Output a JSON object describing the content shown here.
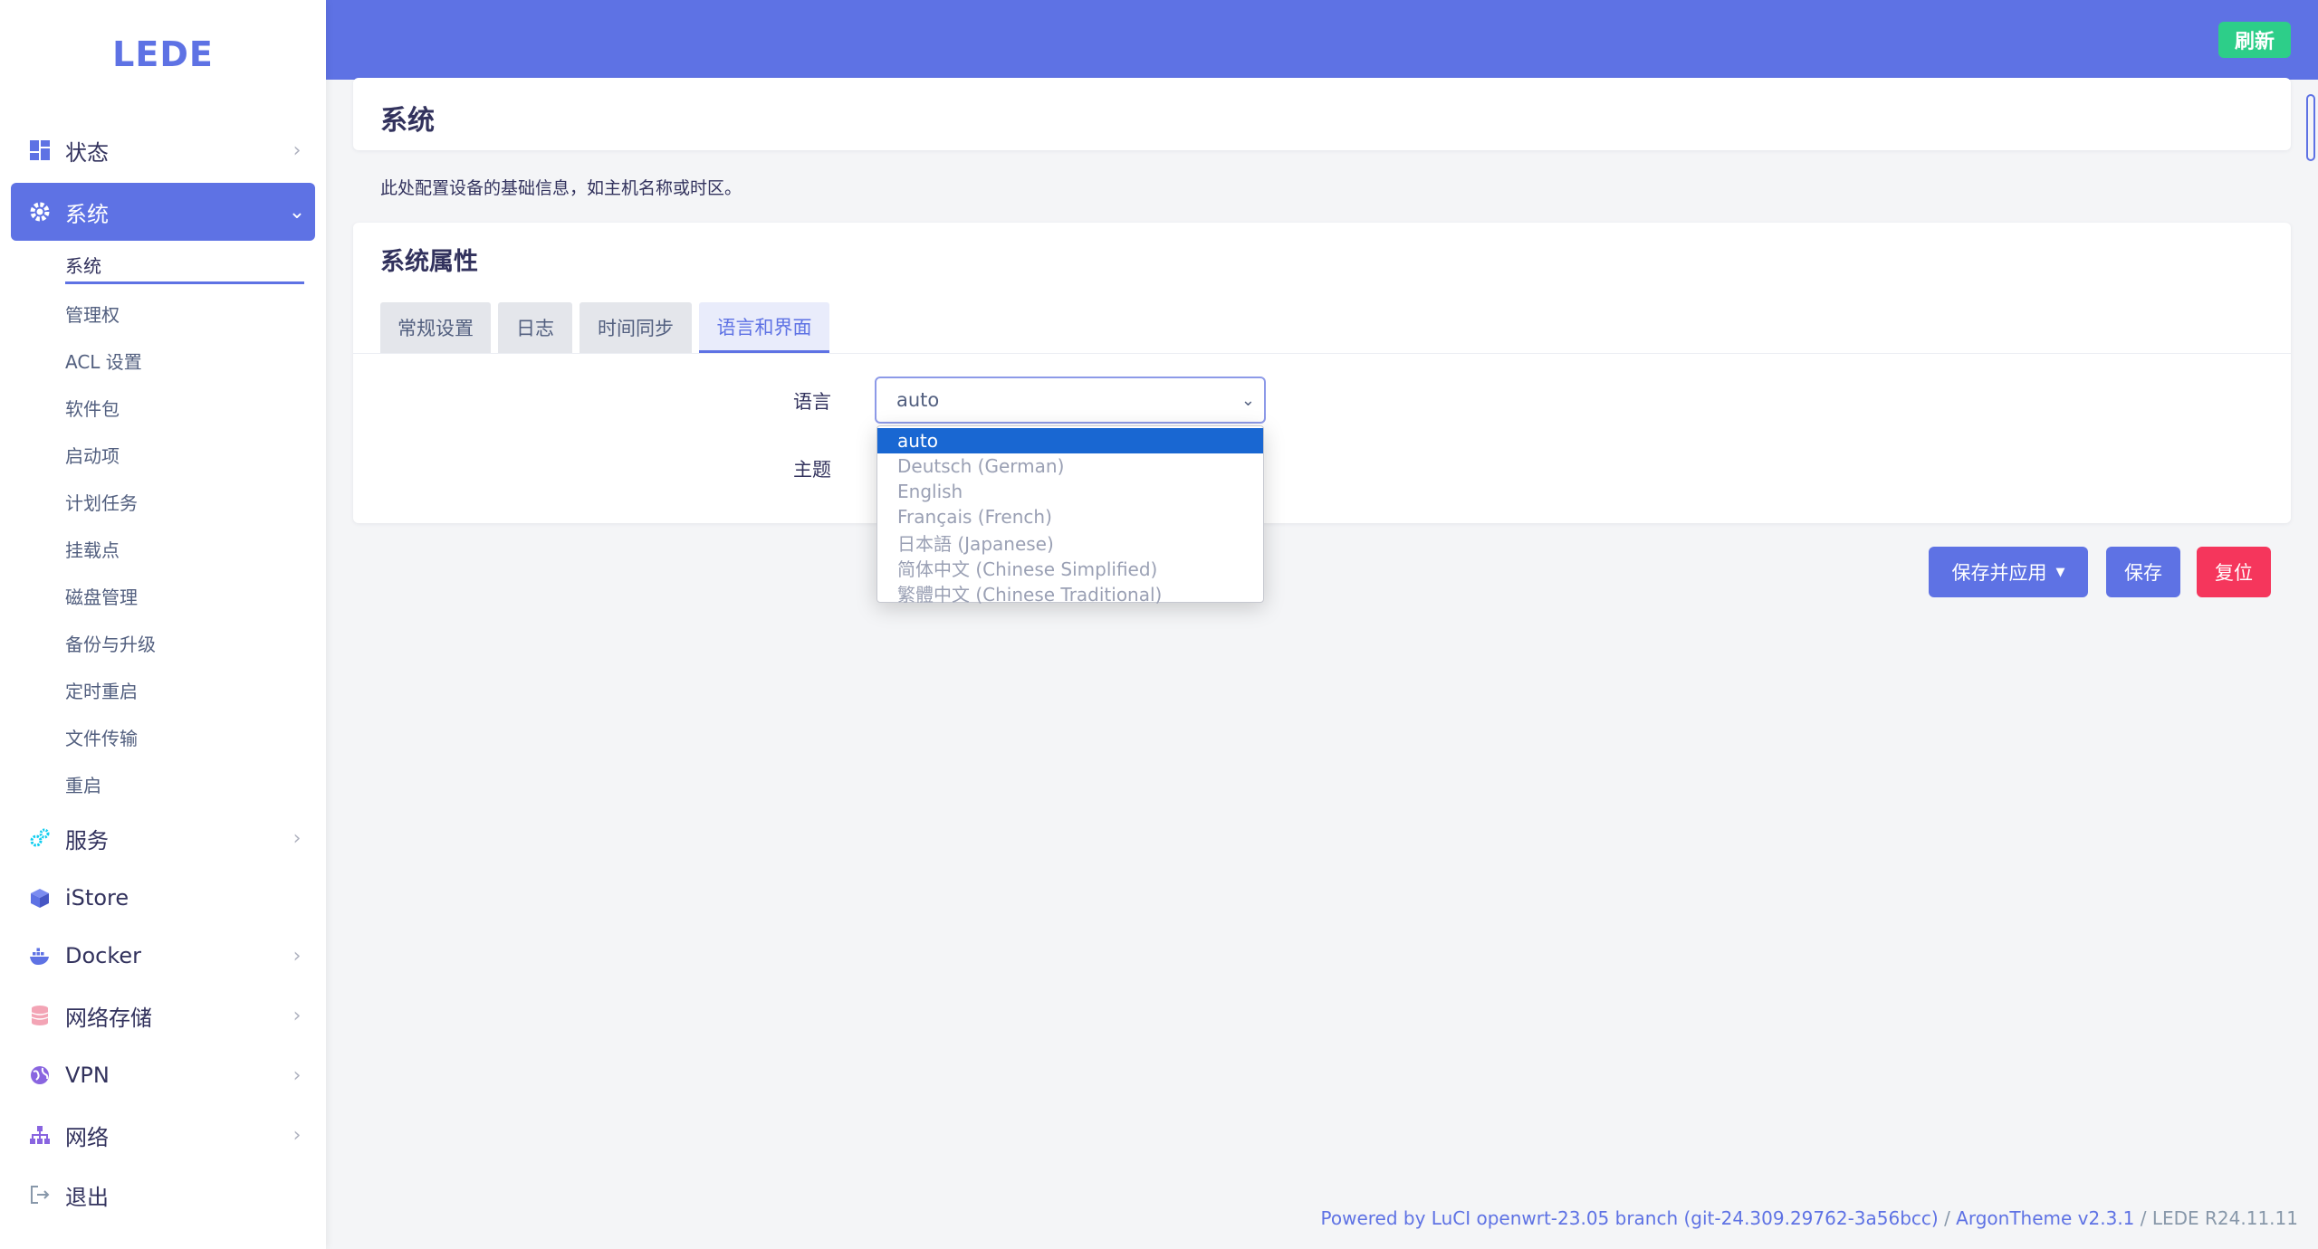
{
  "colors": {
    "accent": "#5e72e4",
    "success": "#2dce89",
    "danger": "#f5365c",
    "dropdown_highlight": "#1967d2"
  },
  "sidebar": {
    "logo": "LEDE",
    "items": [
      {
        "label": "状态",
        "icon": "dashboard-icon"
      },
      {
        "label": "系统",
        "icon": "gear-icon",
        "active": true
      },
      {
        "label": "服务",
        "icon": "gears-icon"
      },
      {
        "label": "iStore",
        "icon": "cube-icon"
      },
      {
        "label": "Docker",
        "icon": "docker-whale-icon"
      },
      {
        "label": "网络存储",
        "icon": "database-icon"
      },
      {
        "label": "VPN",
        "icon": "globe-icon"
      },
      {
        "label": "网络",
        "icon": "network-icon"
      },
      {
        "label": "退出",
        "icon": "logout-icon"
      }
    ],
    "sub_items": [
      {
        "label": "系统",
        "current": true
      },
      {
        "label": "管理权"
      },
      {
        "label": "ACL 设置"
      },
      {
        "label": "软件包"
      },
      {
        "label": "启动项"
      },
      {
        "label": "计划任务"
      },
      {
        "label": "挂载点"
      },
      {
        "label": "磁盘管理"
      },
      {
        "label": "备份与升级"
      },
      {
        "label": "定时重启"
      },
      {
        "label": "文件传输"
      },
      {
        "label": "重启"
      }
    ]
  },
  "header": {
    "refresh_label": "刷新"
  },
  "page": {
    "title": "系统",
    "description": "此处配置设备的基础信息，如主机名称或时区。",
    "section_title": "系统属性",
    "tabs": [
      {
        "label": "常规设置"
      },
      {
        "label": "日志"
      },
      {
        "label": "时间同步"
      },
      {
        "label": "语言和界面",
        "active": true
      }
    ],
    "fields": {
      "language_label": "语言",
      "theme_label": "主题",
      "language_value": "auto"
    },
    "language_options": [
      "auto",
      "Deutsch (German)",
      "English",
      "Français (French)",
      "日本語 (Japanese)",
      "简体中文 (Chinese Simplified)",
      "繁體中文 (Chinese Traditional)"
    ],
    "buttons": {
      "save_apply": "保存并应用",
      "save": "保存",
      "reset": "复位"
    }
  },
  "footer": {
    "powered": "Powered by LuCI openwrt-23.05 branch (git-24.309.29762-3a56bcc)",
    "sep1": " / ",
    "theme": "ArgonTheme v2.3.1",
    "sep2": " / ",
    "version": "LEDE R24.11.11"
  }
}
